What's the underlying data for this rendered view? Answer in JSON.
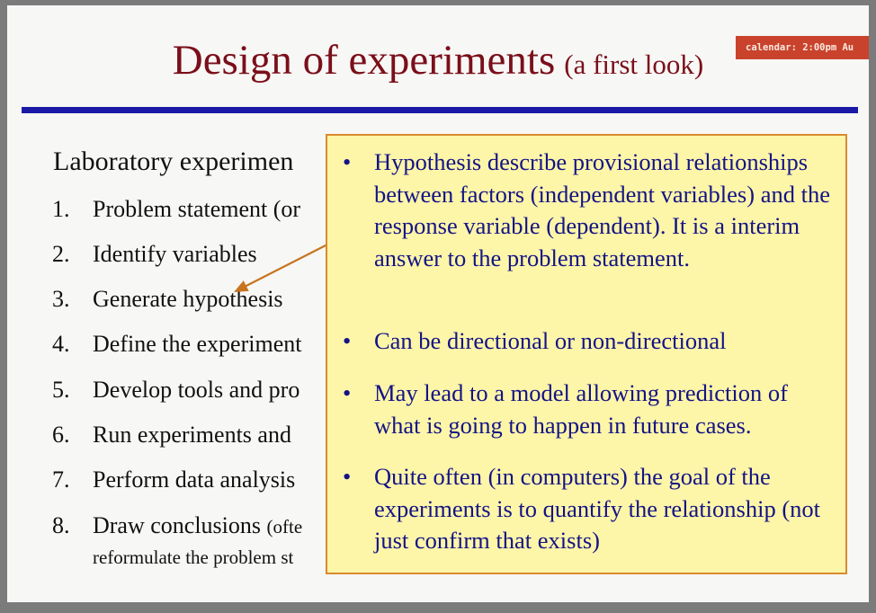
{
  "slide": {
    "title": "Design of experiments",
    "title_sub": "(a first look)",
    "calendar_badge": "calendar: 2:00pm  Au",
    "heading": "Laboratory experimen",
    "steps": [
      {
        "num": "1.",
        "text": "Problem statement (or"
      },
      {
        "num": "2.",
        "text": "Identify variables"
      },
      {
        "num": "3.",
        "text": "Generate hypothesis"
      },
      {
        "num": "4.",
        "text": "Define the experiment"
      },
      {
        "num": "5.",
        "text": "Develop tools and pro"
      },
      {
        "num": "6.",
        "text": "Run experiments and"
      },
      {
        "num": "7.",
        "text": "Perform data analysis"
      },
      {
        "num": "8.",
        "text": "Draw conclusions",
        "small": "(ofte",
        "line2": "reformulate the problem st"
      }
    ]
  },
  "callout": {
    "bullet_symbol": "•",
    "bullets": [
      "Hypothesis describe provisional relationships between factors (independent variables) and the response variable (dependent). It is a interim answer to the problem statement.",
      "Can be directional or non-directional",
      "May lead to a model allowing prediction of what is going to happen in future cases.",
      "Quite often (in computers) the goal of the experiments is to quantify the relationship (not just confirm that exists)"
    ]
  },
  "colors": {
    "title": "#7a0f1a",
    "rule": "#1a1aa6",
    "callout_bg": "#fdf5a8",
    "callout_border": "#d98a2e",
    "callout_text": "#141486",
    "arrow": "#c8741f",
    "badge": "#c9432c"
  }
}
